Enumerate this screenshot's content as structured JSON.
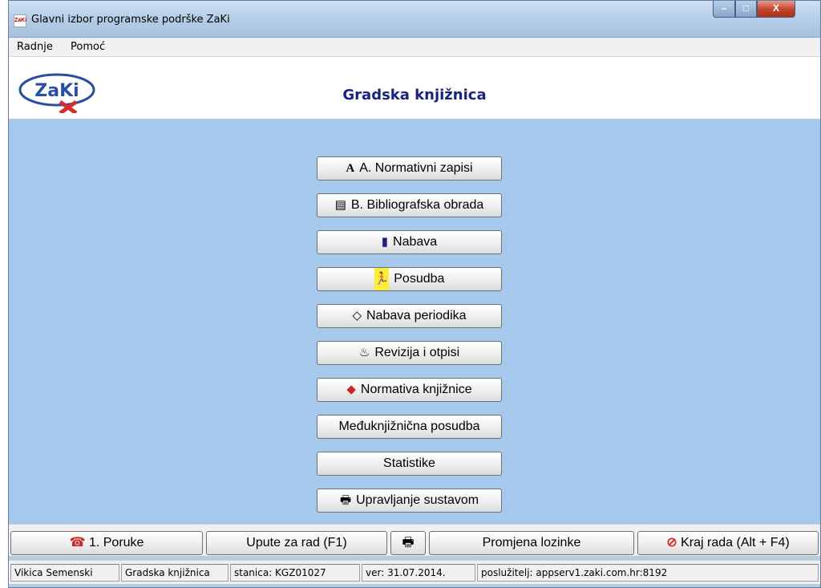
{
  "window": {
    "title": "Glavni izbor programske podrške ZaKi",
    "app_icon_text": "ZaKi",
    "min_label": "–",
    "max_label": "□",
    "close_label": "X"
  },
  "menubar": {
    "items": [
      {
        "label": "Radnje"
      },
      {
        "label": "Pomoć"
      }
    ]
  },
  "header": {
    "logo_text": "ZaKi",
    "title": "Gradska knjižnica"
  },
  "main_buttons": [
    {
      "icon": "A",
      "label": "A. Normativni zapisi"
    },
    {
      "icon": "▤",
      "label": "B. Bibliografska obrada"
    },
    {
      "icon": "▮",
      "label": "Nabava"
    },
    {
      "icon": "🏃",
      "label": "Posudba"
    },
    {
      "icon": "◇",
      "label": "Nabava periodika"
    },
    {
      "icon": "♨",
      "label": "Revizija i otpisi"
    },
    {
      "icon": "◆",
      "label": "Normativa knjižnice"
    },
    {
      "icon": "",
      "label": "Međuknjižnična posudba"
    },
    {
      "icon": "",
      "label": "Statistike"
    },
    {
      "icon": "🖶",
      "label": "Upravljanje sustavom"
    }
  ],
  "bottom_buttons": {
    "messages": {
      "icon": "☎",
      "label": "1. Poruke"
    },
    "help": {
      "label": "Upute za rad (F1)"
    },
    "print": {
      "icon": "🖶"
    },
    "password": {
      "label": "Promjena lozinke"
    },
    "exit": {
      "icon": "⊘",
      "label": "Kraj rada (Alt + F4)"
    }
  },
  "statusbar": {
    "user": "Vikica Semenski",
    "library": "Gradska knjižnica",
    "station": "stanica: KGZ01027",
    "version": "ver: 31.07.2014.",
    "server": "poslužitelj: appserv1.zaki.com.hr:8192"
  },
  "colors": {
    "heading": "#1a237e",
    "main_background": "#a6c8ec",
    "logo_red": "#d32f2f",
    "logo_blue": "#2a4fa0"
  }
}
